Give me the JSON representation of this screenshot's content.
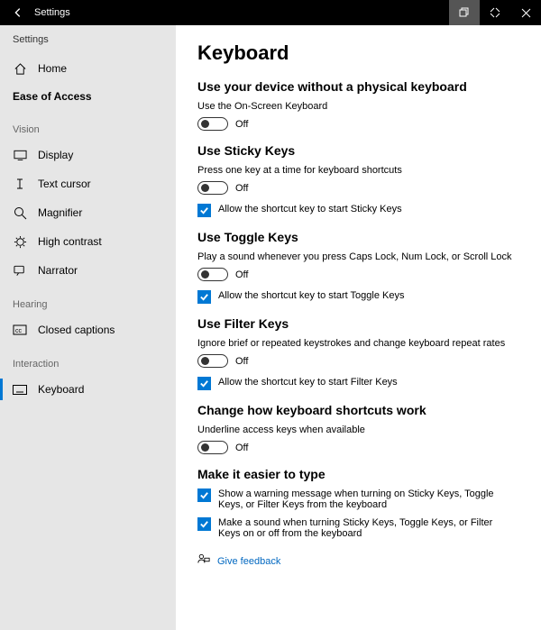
{
  "titlebar": {
    "title": "Settings"
  },
  "sidebar": {
    "crumb": "Settings",
    "home": "Home",
    "section": "Ease of Access",
    "groups": {
      "vision": "Vision",
      "hearing": "Hearing",
      "interaction": "Interaction"
    },
    "items": {
      "display": "Display",
      "text_cursor": "Text cursor",
      "magnifier": "Magnifier",
      "high_contrast": "High contrast",
      "narrator": "Narrator",
      "closed_captions": "Closed captions",
      "keyboard": "Keyboard"
    }
  },
  "page": {
    "title": "Keyboard",
    "sections": {
      "osk": {
        "heading": "Use your device without a physical keyboard",
        "desc": "Use the On-Screen Keyboard",
        "state": "Off"
      },
      "sticky": {
        "heading": "Use Sticky Keys",
        "desc": "Press one key at a time for keyboard shortcuts",
        "state": "Off",
        "check": "Allow the shortcut key to start Sticky Keys"
      },
      "toggle": {
        "heading": "Use Toggle Keys",
        "desc": "Play a sound whenever you press Caps Lock, Num Lock, or Scroll Lock",
        "state": "Off",
        "check": "Allow the shortcut key to start Toggle Keys"
      },
      "filter": {
        "heading": "Use Filter Keys",
        "desc": "Ignore brief or repeated keystrokes and change keyboard repeat rates",
        "state": "Off",
        "check": "Allow the shortcut key to start Filter Keys"
      },
      "shortcuts": {
        "heading": "Change how keyboard shortcuts work",
        "desc": "Underline access keys when available",
        "state": "Off"
      },
      "easier": {
        "heading": "Make it easier to type",
        "check1": "Show a warning message when turning on Sticky Keys, Toggle Keys, or Filter Keys from the keyboard",
        "check2": "Make a sound when turning Sticky Keys, Toggle Keys, or Filter Keys on or off from the keyboard"
      }
    },
    "feedback": "Give feedback"
  }
}
